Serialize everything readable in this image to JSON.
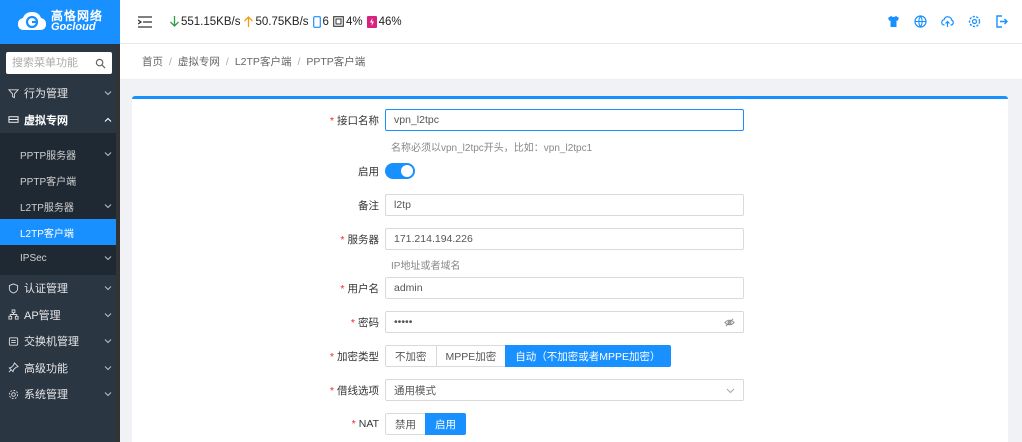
{
  "brand": {
    "name_cn": "高恪网络",
    "name_en": "Gocloud",
    "color": "#1890ff"
  },
  "topbar": {
    "download": "551.15KB/s",
    "upload": "50.75KB/s",
    "devices": "6",
    "cpu": "4%",
    "mem": "46%"
  },
  "sidebar": {
    "search_placeholder": "搜索菜单功能",
    "items": [
      {
        "label": "行为管理",
        "icon": "filter-icon"
      },
      {
        "label": "虚拟专网",
        "icon": "vpn-icon",
        "open": true
      },
      {
        "label": "认证管理",
        "icon": "shield-icon"
      },
      {
        "label": "AP管理",
        "icon": "ap-icon"
      },
      {
        "label": "交换机管理",
        "icon": "switch-icon"
      },
      {
        "label": "高级功能",
        "icon": "pin-icon"
      },
      {
        "label": "系统管理",
        "icon": "gear-icon"
      }
    ],
    "submenu": [
      {
        "label": "PPTP服务器",
        "has_children": true
      },
      {
        "label": "PPTP客户端",
        "has_children": false
      },
      {
        "label": "L2TP服务器",
        "has_children": true
      },
      {
        "label": "L2TP客户端",
        "has_children": false,
        "active": true
      },
      {
        "label": "IPSec",
        "has_children": true
      }
    ]
  },
  "breadcrumb": [
    "首页",
    "虚拟专网",
    "L2TP客户端",
    "PPTP客户端"
  ],
  "form": {
    "iface_label": "接口名称",
    "iface_value": "vpn_l2tpc",
    "iface_help": "名称必须以vpn_l2tpc开头，比如：vpn_l2tpc1",
    "enable_label": "启用",
    "enabled": true,
    "note_label": "备注",
    "note_value": "l2tp",
    "server_label": "服务器",
    "server_value": "171.214.194.226",
    "server_help": "IP地址或者域名",
    "user_label": "用户名",
    "user_value": "admin",
    "pwd_label": "密码",
    "pwd_value": "•••••",
    "enc_label": "加密类型",
    "enc_options": [
      "不加密",
      "MPPE加密",
      "自动（不加密或者MPPE加密）"
    ],
    "enc_selected": 2,
    "line_label": "借线选项",
    "line_value": "通用模式",
    "nat_label": "NAT",
    "nat_options": [
      "禁用",
      "启用"
    ],
    "nat_selected": 1
  }
}
